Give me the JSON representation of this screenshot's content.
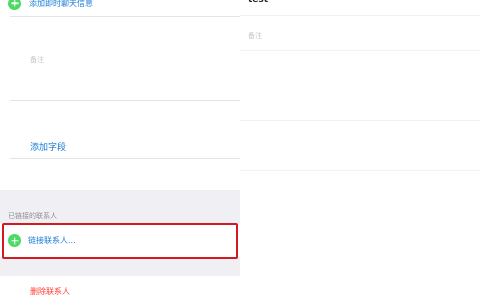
{
  "left": {
    "add_im": "添加即时聊天信息",
    "note_label": "备注",
    "add_field": "添加字段",
    "linked_header": "已链接的联系人",
    "link_contacts": "链接联系人...",
    "delete_contact": "删除联系人"
  },
  "right": {
    "title": "test",
    "note_label": "备注"
  },
  "colors": {
    "accent_blue": "#1a7ad8",
    "green_add": "#4cd964",
    "highlight_red": "#d11a22",
    "delete_red": "#ff3b30",
    "group_gray": "#efeff4"
  },
  "icons": {
    "add": "plus-circle-icon"
  }
}
